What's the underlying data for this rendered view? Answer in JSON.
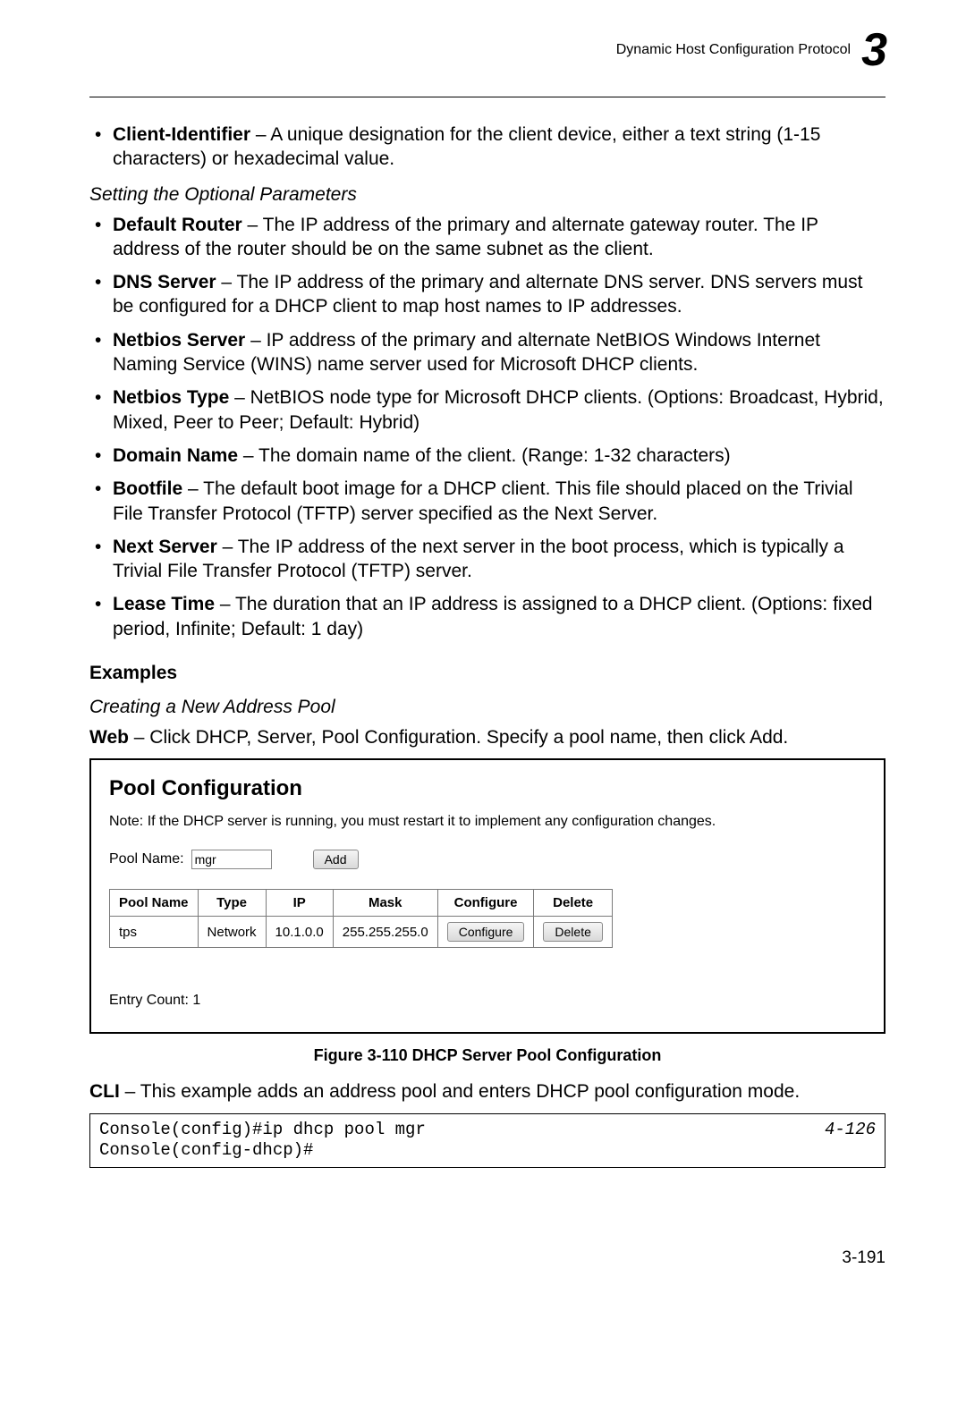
{
  "header": {
    "title": "Dynamic Host Configuration Protocol",
    "chapter": "3"
  },
  "top_bullets": [
    {
      "term": "Client-Identifier",
      "desc": " – A unique designation for the client device, either a text string (1-15 characters) or hexadecimal value."
    }
  ],
  "optional_heading": "Setting the Optional Parameters",
  "optional_bullets": [
    {
      "term": "Default Router",
      "desc": " – The IP address of the primary and alternate gateway router. The IP address of the router should be on the same subnet as the client."
    },
    {
      "term": "DNS Server",
      "desc": " – The IP address of the primary and alternate DNS server. DNS servers must be configured for a DHCP client to map host names to IP addresses."
    },
    {
      "term": "Netbios Server",
      "desc": " – IP address of the primary and alternate NetBIOS Windows Internet Naming Service (WINS) name server used for Microsoft DHCP clients."
    },
    {
      "term": "Netbios Type",
      "desc": " – NetBIOS node type for Microsoft DHCP clients. (Options: Broadcast, Hybrid, Mixed, Peer to Peer; Default: Hybrid)"
    },
    {
      "term": "Domain Name",
      "desc": " – The domain name of the client. (Range: 1-32 characters)"
    },
    {
      "term": "Bootfile",
      "desc": " – The default boot image for a DHCP client. This file should placed on the Trivial File Transfer Protocol (TFTP) server specified as the Next Server."
    },
    {
      "term": "Next Server",
      "desc": " – The IP address of the next server in the boot process, which is typically a Trivial File Transfer Protocol (TFTP) server."
    },
    {
      "term": "Lease Time",
      "desc": " – The duration that an IP address is assigned to a DHCP client. (Options: fixed period, Infinite; Default: 1 day)"
    }
  ],
  "examples_heading": "Examples",
  "creating_heading": "Creating a New Address Pool",
  "web_line_prefix": "Web",
  "web_line_rest": " – Click DHCP, Server, Pool Configuration. Specify a pool name, then click Add.",
  "figure": {
    "title": "Pool Configuration",
    "note": "Note: If the DHCP server is running, you must restart it to implement any configuration changes.",
    "pool_name_label": "Pool Name:",
    "pool_name_value": "mgr",
    "add_label": "Add",
    "table": {
      "headers": [
        "Pool Name",
        "Type",
        "IP",
        "Mask",
        "Configure",
        "Delete"
      ],
      "row": {
        "name": "tps",
        "type": "Network",
        "ip": "10.1.0.0",
        "mask": "255.255.255.0",
        "configure": "Configure",
        "delete": "Delete"
      }
    },
    "entry_count": "Entry Count: 1",
    "caption": "Figure 3-110   DHCP Server Pool Configuration"
  },
  "cli_prefix": "CLI",
  "cli_rest": " – This example adds an address pool and enters DHCP pool configuration mode.",
  "cli_box": {
    "left": "Console(config)#ip dhcp pool mgr\nConsole(config-dhcp)#",
    "right": "4-126"
  },
  "page_number": "3-191"
}
